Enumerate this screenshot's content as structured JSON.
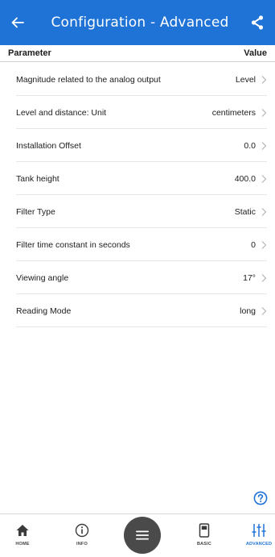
{
  "header": {
    "title": "Configuration - Advanced",
    "back_icon": "arrow-left-icon",
    "share_icon": "share-icon"
  },
  "table": {
    "col_parameter": "Parameter",
    "col_value": "Value",
    "rows": [
      {
        "label": "Magnitude related to the analog output",
        "value": "Level"
      },
      {
        "label": "Level and distance: Unit",
        "value": "centimeters"
      },
      {
        "label": "Installation Offset",
        "value": "0.0"
      },
      {
        "label": "Tank height",
        "value": "400.0"
      },
      {
        "label": "Filter Type",
        "value": "Static"
      },
      {
        "label": "Filter time constant in seconds",
        "value": "0"
      },
      {
        "label": "Viewing angle",
        "value": "17°"
      },
      {
        "label": "Reading Mode",
        "value": "long"
      }
    ]
  },
  "help_icon": "question-circle-icon",
  "nav": {
    "home": "HOME",
    "info": "INFO",
    "basic": "BASIC",
    "advanced": "ADVANCED",
    "menu_icon": "hamburger-menu-icon"
  },
  "colors": {
    "accent": "#1f73d6",
    "fab": "#4a4a4a"
  }
}
